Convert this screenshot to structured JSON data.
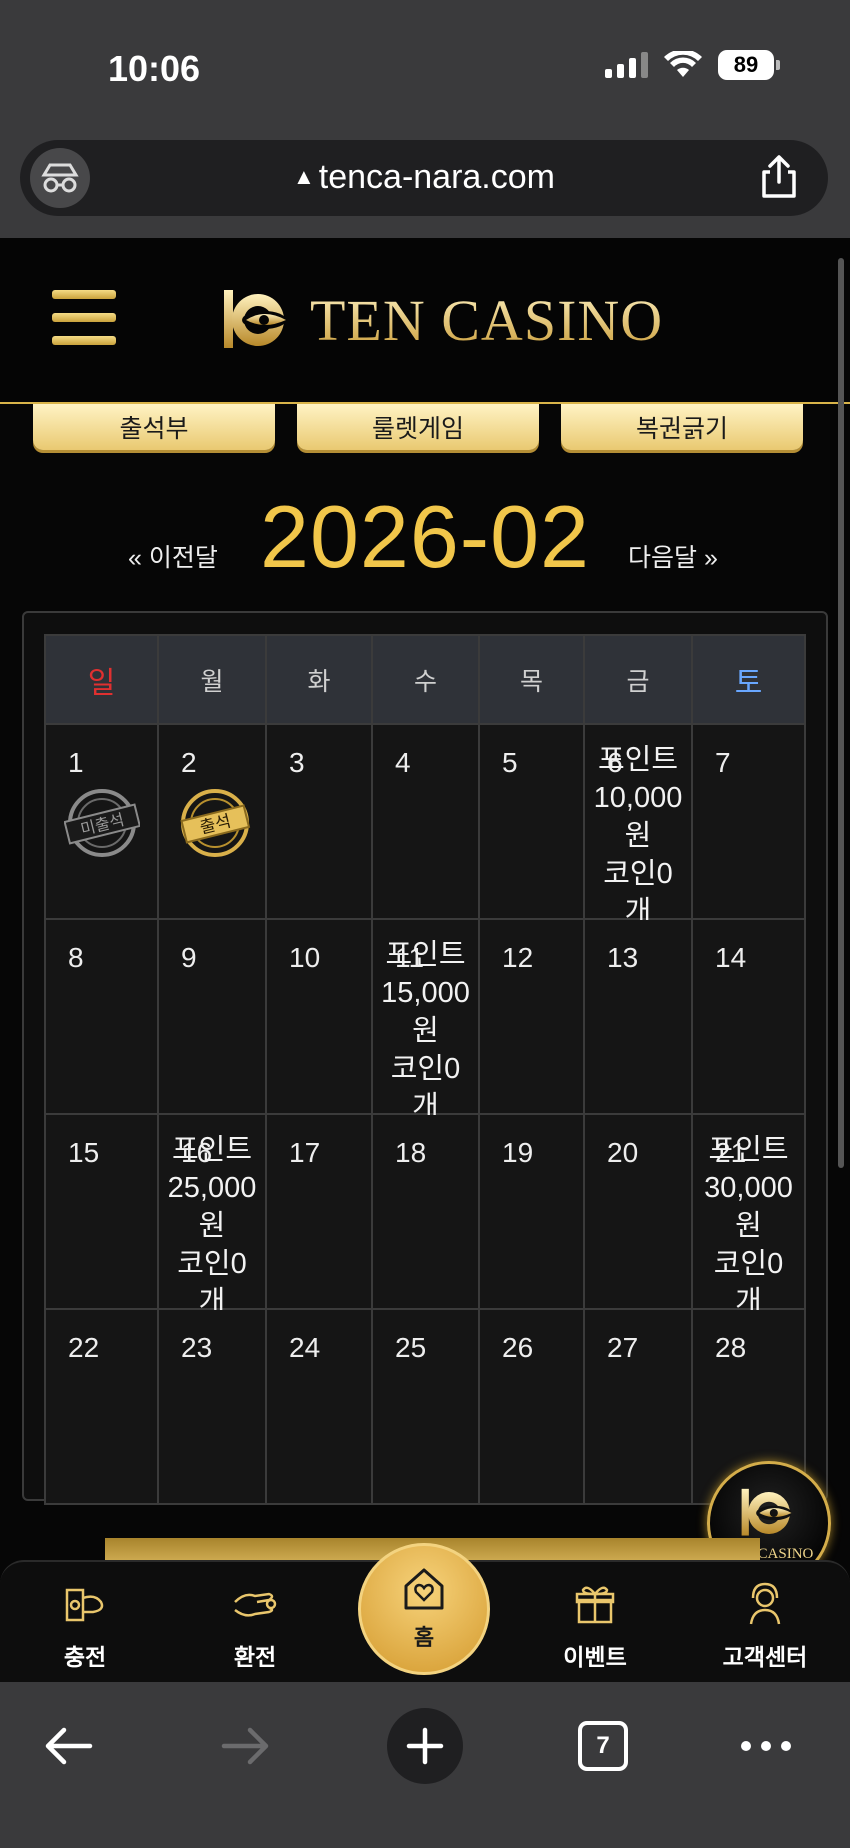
{
  "status_bar": {
    "time": "10:06",
    "battery": "89"
  },
  "browser": {
    "url": "tenca-nara.com",
    "tab_count": "7"
  },
  "site": {
    "logo_text": "TEN CASINO",
    "float_logo_text": "TEN CASINO"
  },
  "tabs": [
    {
      "label": "출석부"
    },
    {
      "label": "룰렛게임"
    },
    {
      "label": "복권긁기"
    }
  ],
  "month_nav": {
    "prev_label": "« 이전달",
    "title": "2026-02",
    "next_label": "다음달 »"
  },
  "calendar": {
    "weekdays": [
      "일",
      "월",
      "화",
      "수",
      "목",
      "금",
      "토"
    ],
    "weeks": [
      [
        {
          "day": "1",
          "stamp": "미출석"
        },
        {
          "day": "2",
          "stamp": "출석"
        },
        {
          "day": "3"
        },
        {
          "day": "4"
        },
        {
          "day": "5"
        },
        {
          "day": "6",
          "reward": [
            "포인트",
            "10,000",
            "원",
            "코인0",
            "개"
          ]
        },
        {
          "day": "7"
        }
      ],
      [
        {
          "day": "8"
        },
        {
          "day": "9"
        },
        {
          "day": "10"
        },
        {
          "day": "11",
          "reward": [
            "포인트",
            "15,000",
            "원",
            "코인0",
            "개"
          ]
        },
        {
          "day": "12"
        },
        {
          "day": "13"
        },
        {
          "day": "14"
        }
      ],
      [
        {
          "day": "15"
        },
        {
          "day": "16",
          "reward": [
            "포인트",
            "25,000",
            "원",
            "코인0",
            "개"
          ]
        },
        {
          "day": "17"
        },
        {
          "day": "18"
        },
        {
          "day": "19"
        },
        {
          "day": "20"
        },
        {
          "day": "21",
          "reward": [
            "포인트",
            "30,000",
            "원",
            "코인0",
            "개"
          ]
        }
      ],
      [
        {
          "day": "22"
        },
        {
          "day": "23"
        },
        {
          "day": "24"
        },
        {
          "day": "25"
        },
        {
          "day": "26"
        },
        {
          "day": "27"
        },
        {
          "day": "28"
        }
      ]
    ]
  },
  "bottom_nav": [
    {
      "label": "충전",
      "icon": "charge-icon"
    },
    {
      "label": "환전",
      "icon": "exchange-icon"
    },
    {
      "label": "홈",
      "icon": "home-icon"
    },
    {
      "label": "이벤트",
      "icon": "gift-icon"
    },
    {
      "label": "고객센터",
      "icon": "support-icon"
    }
  ],
  "colors": {
    "gold": "#f1c64a",
    "sunday": "#e03030",
    "saturday": "#69a7ff",
    "background": "#060606"
  }
}
